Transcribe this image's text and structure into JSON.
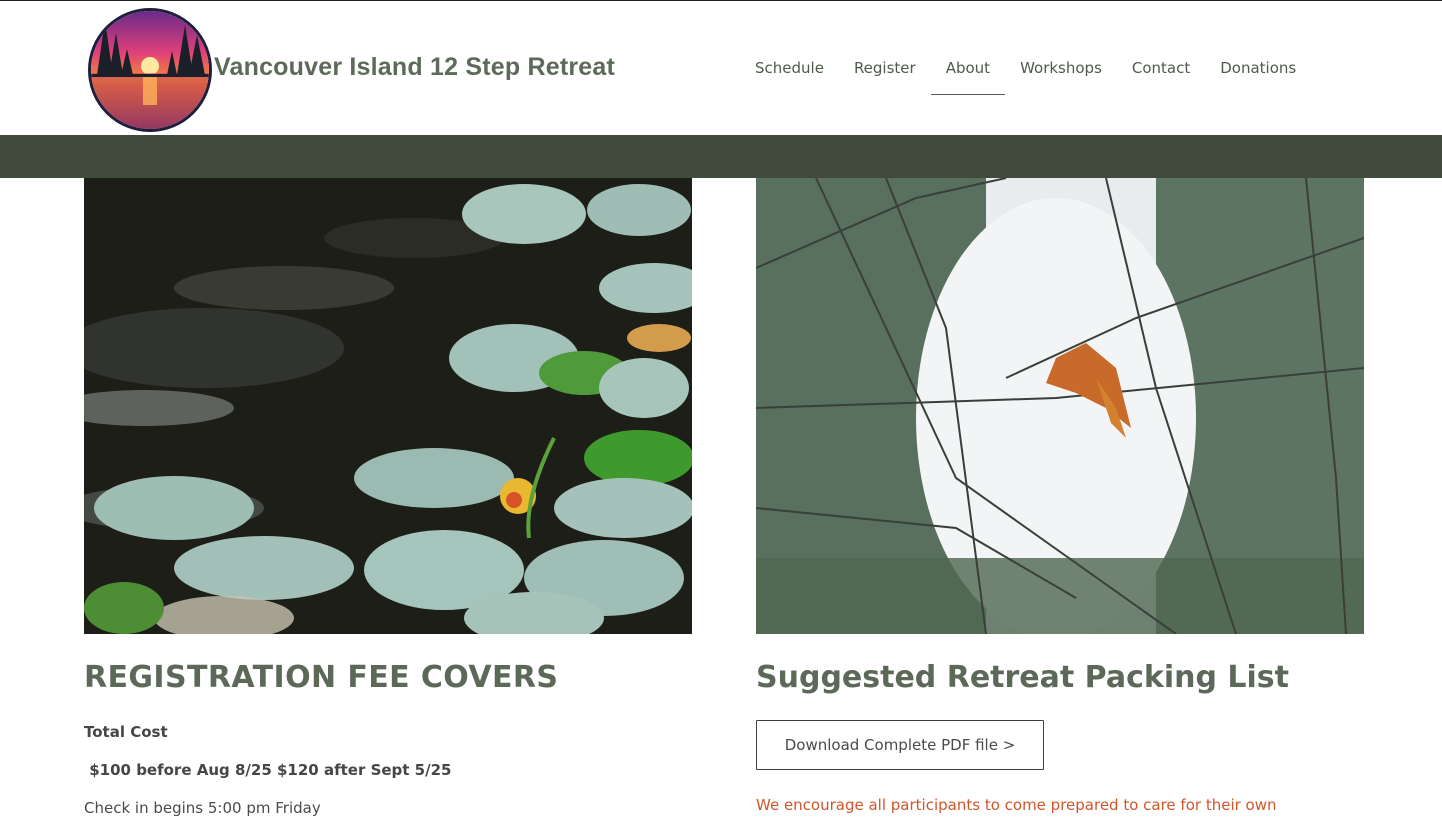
{
  "header": {
    "site_title": "Vancouver Island 12 Step Retreat",
    "logo_icon": "sunset-lake-logo"
  },
  "nav": {
    "items": [
      {
        "label": "Schedule",
        "active": false
      },
      {
        "label": "Register",
        "active": false
      },
      {
        "label": "About",
        "active": true
      },
      {
        "label": "Workshops",
        "active": false
      },
      {
        "label": "Contact",
        "active": false
      },
      {
        "label": "Donations",
        "active": false
      }
    ]
  },
  "colors": {
    "band": "#414b3b",
    "heading": "#5c6858",
    "accent_text": "#d0562a"
  },
  "left_column": {
    "image": "water-lilies-photo",
    "heading": "REGISTRATION FEE COVERS",
    "total_cost_label": "Total Cost",
    "prices": " $100 before Aug 8/25 $120 after Sept 5/25",
    "check_in": "Check in begins 5:00 pm Friday"
  },
  "right_column": {
    "image": "forest-branches-photo",
    "heading": "Suggested Retreat Packing List",
    "download_button": "Download Complete PDF file >",
    "notice": "We encourage all participants to come prepared to care for their own"
  }
}
